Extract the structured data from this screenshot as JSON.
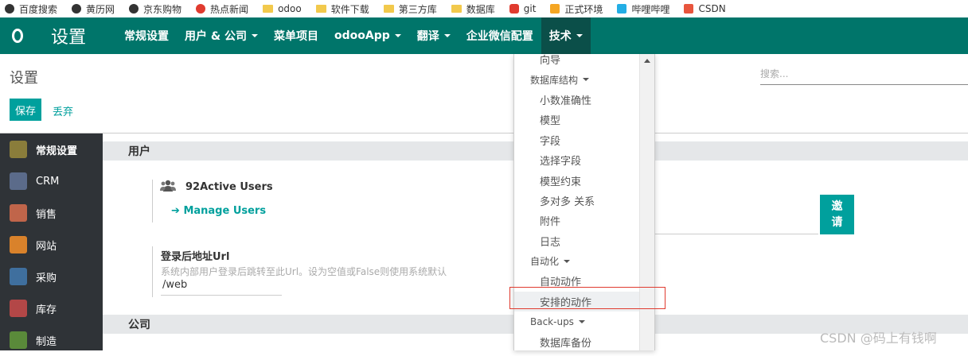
{
  "bookmarks": [
    {
      "label": "百度搜索",
      "icon": "globe-icon"
    },
    {
      "label": "黄历网",
      "icon": "globe-icon"
    },
    {
      "label": "京东购物",
      "icon": "globe-icon"
    },
    {
      "label": "热点新闻",
      "icon": "news-icon"
    },
    {
      "label": "odoo",
      "icon": "folder-icon"
    },
    {
      "label": "软件下载",
      "icon": "folder-icon"
    },
    {
      "label": "第三方库",
      "icon": "folder-icon"
    },
    {
      "label": "数据库",
      "icon": "folder-icon"
    },
    {
      "label": "git",
      "icon": "git-icon"
    },
    {
      "label": "正式环境",
      "icon": "bolt-icon"
    },
    {
      "label": "哔哩哔哩",
      "icon": "bilibili-icon"
    },
    {
      "label": "CSDN",
      "icon": "csdn-icon"
    }
  ],
  "app": {
    "title": "设置"
  },
  "menu": [
    {
      "label": "常规设置",
      "caret": false
    },
    {
      "label": "用户 & 公司",
      "caret": true
    },
    {
      "label": "菜单项目",
      "caret": false
    },
    {
      "label": "odooApp",
      "caret": true
    },
    {
      "label": "翻译",
      "caret": true
    },
    {
      "label": "企业微信配置",
      "caret": false
    },
    {
      "label": "技术",
      "caret": true
    }
  ],
  "control_panel": {
    "title": "设置",
    "search_placeholder": "搜索...",
    "save_label": "保存",
    "discard_label": "丢弃"
  },
  "sidebar": [
    {
      "label": "常规设置",
      "color": "#8a7d3b",
      "active": true
    },
    {
      "label": "CRM",
      "color": "#5b6b8a"
    },
    {
      "label": "销售",
      "color": "#c0654a"
    },
    {
      "label": "网站",
      "color": "#d9822b"
    },
    {
      "label": "采购",
      "color": "#3f6f9e"
    },
    {
      "label": "库存",
      "color": "#b34747"
    },
    {
      "label": "制造",
      "color": "#5a8a3a"
    }
  ],
  "sections": {
    "users": "用户",
    "company": "公司"
  },
  "users": {
    "active_label": "92Active Users",
    "manage_label": "Manage Users",
    "invite_label_1": "邀",
    "invite_label_2": "请"
  },
  "login_url": {
    "label": "登录后地址Url",
    "description": "系统内部用户登录后跳转至此Url。设为空值或False则使用系统默认",
    "value": "/web"
  },
  "dropdown": [
    {
      "type": "item",
      "label": "向导"
    },
    {
      "type": "header",
      "label": "数据库结构"
    },
    {
      "type": "item",
      "label": "小数准确性"
    },
    {
      "type": "item",
      "label": "模型"
    },
    {
      "type": "item",
      "label": "字段"
    },
    {
      "type": "item",
      "label": "选择字段"
    },
    {
      "type": "item",
      "label": "模型约束"
    },
    {
      "type": "item",
      "label": "多对多 关系"
    },
    {
      "type": "item",
      "label": "附件"
    },
    {
      "type": "item",
      "label": "日志"
    },
    {
      "type": "header",
      "label": "自动化"
    },
    {
      "type": "item",
      "label": "自动动作"
    },
    {
      "type": "item",
      "label": "安排的动作",
      "highlight": true
    },
    {
      "type": "header",
      "label": "Back-ups"
    },
    {
      "type": "item",
      "label": "数据库备份"
    }
  ],
  "watermark": "CSDN @码上有钱啊",
  "colors": {
    "brand": "#00756a",
    "accent": "#00a09d",
    "sidebar": "#2f3337",
    "highlight_border": "#e03b2f"
  }
}
